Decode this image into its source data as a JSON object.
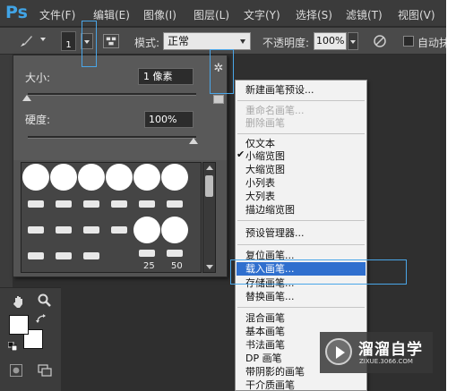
{
  "app_logo": "Ps",
  "menu": [
    "文件(F)",
    "编辑(E)",
    "图像(I)",
    "图层(L)",
    "文字(Y)",
    "选择(S)",
    "滤镜(T)",
    "视图(V)"
  ],
  "options_bar": {
    "brush_size": "1",
    "mode_label": "模式:",
    "mode_value": "正常",
    "opacity_label": "不透明度:",
    "opacity_value": "100%",
    "airbrush_label": "自动抹"
  },
  "brush_picker": {
    "size_label": "大小:",
    "size_value": "1 像素",
    "size_slider": 0.0,
    "hardness_label": "硬度:",
    "hardness_value": "100%",
    "hardness_slider": 1.0,
    "gear_icon": "gear-icon",
    "preset_numbers": [
      "25",
      "50"
    ]
  },
  "context_menu": {
    "items": [
      {
        "label": "新建画笔预设...",
        "disabled": false
      },
      {
        "label": "重命名画笔...",
        "disabled": true
      },
      {
        "label": "删除画笔",
        "disabled": true
      },
      {
        "label": "仅文本",
        "disabled": false
      },
      {
        "label": "小缩览图",
        "disabled": false,
        "checked": true
      },
      {
        "label": "大缩览图",
        "disabled": false
      },
      {
        "label": "小列表",
        "disabled": false
      },
      {
        "label": "大列表",
        "disabled": false
      },
      {
        "label": "描边缩览图",
        "disabled": false
      },
      {
        "label": "预设管理器...",
        "disabled": false
      },
      {
        "label": "复位画笔...",
        "disabled": false
      },
      {
        "label": "载入画笔...",
        "disabled": false,
        "highlighted": true
      },
      {
        "label": "存储画笔...",
        "disabled": false
      },
      {
        "label": "替换画笔...",
        "disabled": false
      },
      {
        "label": "混合画笔",
        "disabled": false
      },
      {
        "label": "基本画笔",
        "disabled": false
      },
      {
        "label": "书法画笔",
        "disabled": false
      },
      {
        "label": "DP 画笔",
        "disabled": false
      },
      {
        "label": "带阴影的画笔",
        "disabled": false
      },
      {
        "label": "干介质画笔",
        "disabled": false
      }
    ]
  },
  "watermark": {
    "title": "溜溜自学",
    "url": "ZIXUE.3066.COM"
  },
  "colors": {
    "accent_highlight": "#2f6fce",
    "annotation_box": "#4aa6e8",
    "ps_logo": "#41a4e6"
  }
}
